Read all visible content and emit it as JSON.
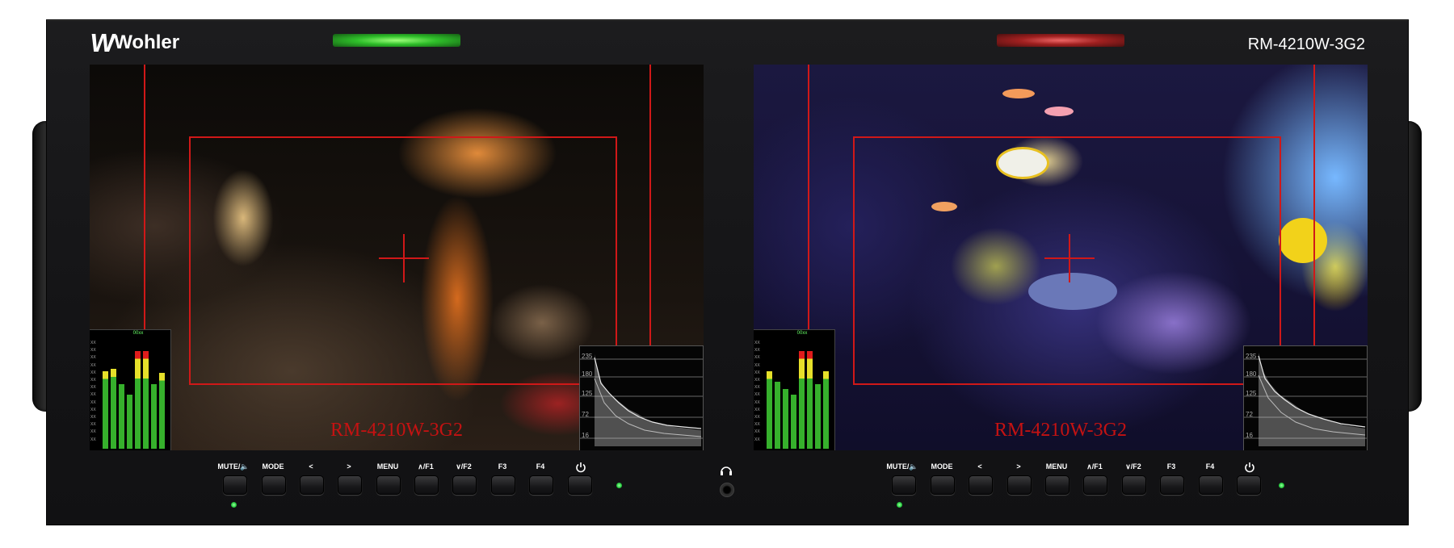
{
  "brand": {
    "logo_mark": "W",
    "logo_text": "Wohler"
  },
  "model": "RM-4210W-3G2",
  "tally": {
    "left": "green",
    "right": "red",
    "colors": {
      "green": "#2fbf2a",
      "red": "#a02020"
    }
  },
  "monitors": [
    {
      "id": "monitor-1",
      "watermark": "RM-4210W-3G2",
      "meter_tag": "00xx",
      "meter_levels": [
        0.72,
        0.74,
        0.6,
        0.5,
        0.9,
        0.9,
        0.6,
        0.7
      ],
      "waveform_scale": [
        "235",
        "180",
        "125",
        "72",
        "16"
      ]
    },
    {
      "id": "monitor-2",
      "watermark": "RM-4210W-3G2",
      "meter_tag": "00xx",
      "meter_levels": [
        0.72,
        0.62,
        0.55,
        0.5,
        0.9,
        0.9,
        0.6,
        0.72
      ],
      "waveform_scale": [
        "235",
        "180",
        "125",
        "72",
        "16"
      ]
    }
  ],
  "meter_scale_marks": [
    "XX",
    "XX",
    "XX",
    "XX",
    "XX",
    "XX",
    "XX",
    "XX",
    "XX",
    "XX",
    "XX",
    "XX",
    "XX",
    "XX"
  ],
  "controls": {
    "left": [
      "MUTE/🔈",
      "MODE",
      "<",
      ">",
      "MENU",
      "∧/F1",
      "∨/F2",
      "F3",
      "F4",
      "power-icon"
    ],
    "right": [
      "MUTE/🔈",
      "MODE",
      "<",
      ">",
      "MENU",
      "∧/F1",
      "∨/F2",
      "F3",
      "F4",
      "power-icon"
    ]
  },
  "labels": {
    "mute": "MUTE/🔈",
    "mode": "MODE",
    "left": "<",
    "right": ">",
    "menu": "MENU",
    "f1": "∧/F1",
    "f2": "∨/F2",
    "f3": "F3",
    "f4": "F4"
  },
  "icons": {
    "headphones": "headphones-icon",
    "power": "power-icon"
  },
  "accent_colors": {
    "safe_area": "#d01818",
    "meter_green": "#36b02c",
    "meter_yellow": "#e6e02a",
    "meter_red": "#e01c1c"
  }
}
